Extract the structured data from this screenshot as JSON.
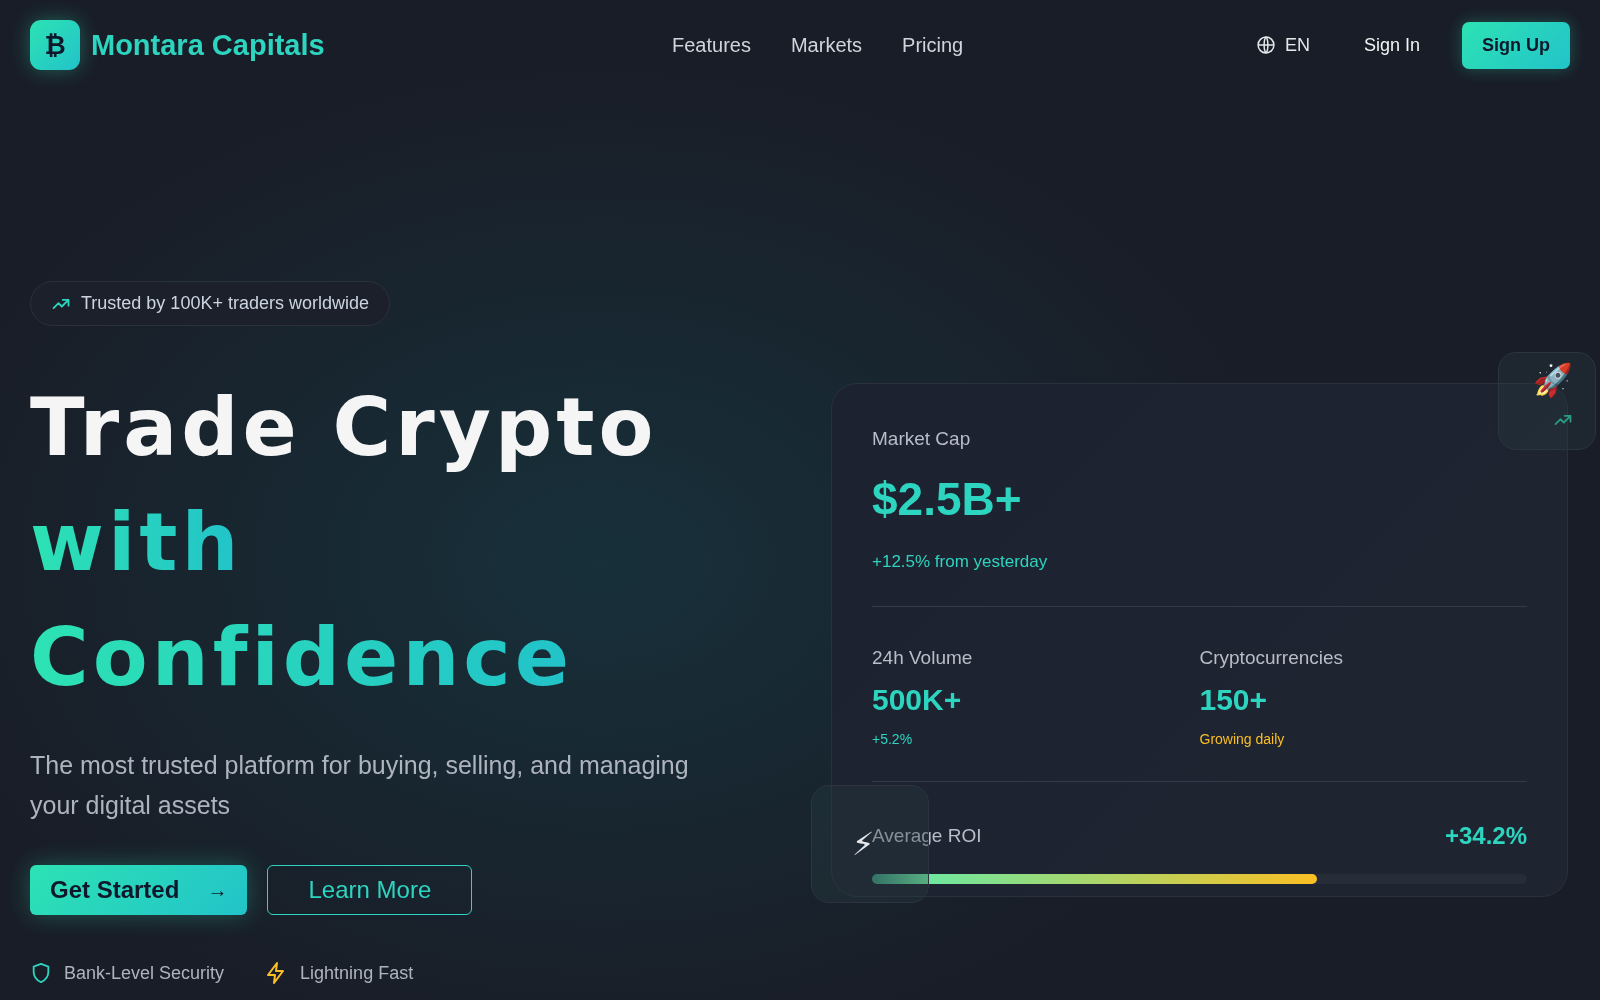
{
  "brand": {
    "logo_glyph": "₿",
    "name": "Montara Capitals"
  },
  "nav": [
    {
      "label": "Features"
    },
    {
      "label": "Markets"
    },
    {
      "label": "Pricing"
    }
  ],
  "language": "EN",
  "sign_in": "Sign In",
  "sign_up": "Sign Up",
  "badge": "Trusted by 100K+ traders worldwide",
  "headline": [
    {
      "text": "Trade Crypto",
      "highlight": false
    },
    {
      "text": "with",
      "highlight": true
    },
    {
      "text": "Confidence",
      "highlight": true
    }
  ],
  "subtitle": "The most trusted platform for buying, selling, and managing your digital assets",
  "buttons": [
    {
      "label": "Get Started",
      "kind": "primary",
      "arrow": "→"
    },
    {
      "label": "Learn More",
      "kind": "outline"
    }
  ],
  "features": [
    {
      "label": "Bank-Level Security",
      "kind": "shield"
    },
    {
      "label": "Lightning Fast",
      "kind": "bolt"
    }
  ],
  "stats_card": {
    "market_cap": {
      "label": "Market Cap",
      "value": "$2.5B+",
      "change": "+12.5% from yesterday"
    },
    "stats": [
      {
        "label": "24h Volume",
        "value": "500K+",
        "note": "+5.2%",
        "color": "#2dd4bf"
      },
      {
        "label": "Cryptocurrencies",
        "value": "150+",
        "note": "Growing daily",
        "color": "#fbbf24"
      }
    ],
    "roi": {
      "label": "Average ROI",
      "value": "+34.2%",
      "level": 0.68
    }
  },
  "floating": [
    {
      "emoji": "🚀"
    },
    {
      "emoji": "⚡"
    }
  ]
}
